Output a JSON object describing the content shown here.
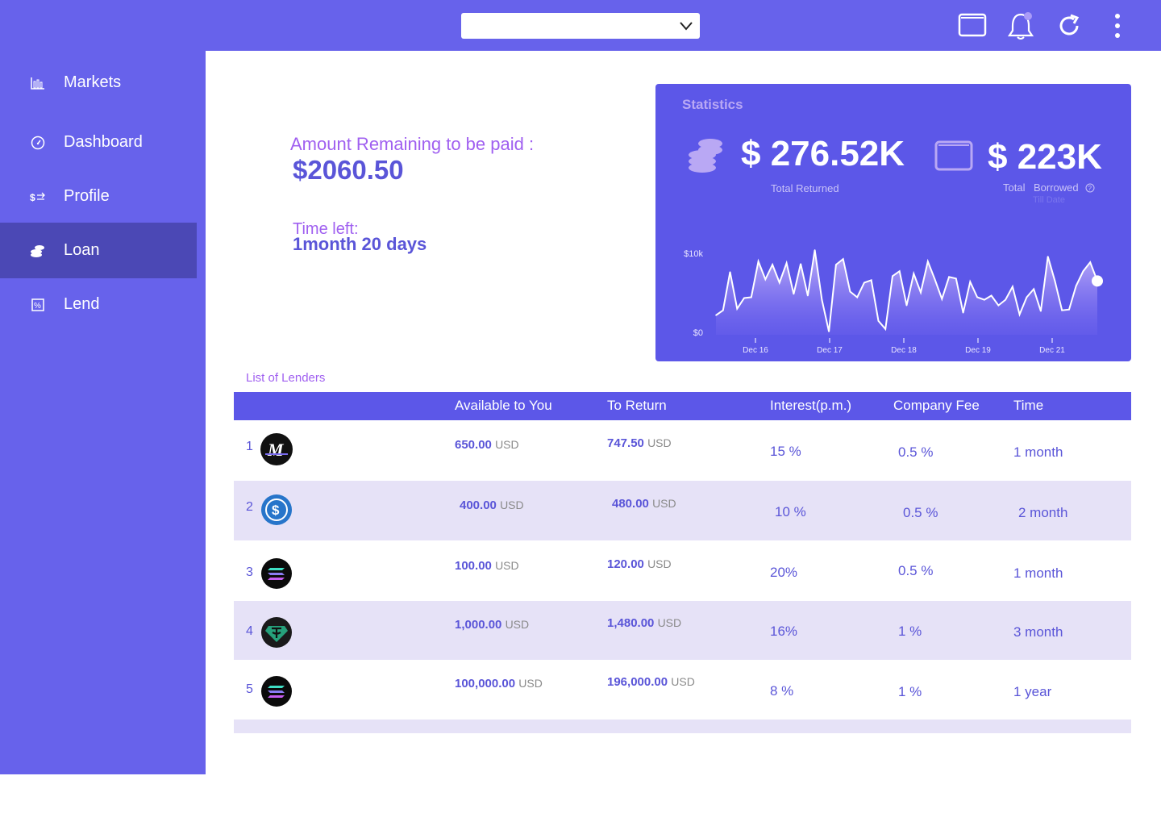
{
  "topbar": {
    "select_value": "",
    "icons": [
      "wallet-icon",
      "bell-icon",
      "refresh-icon",
      "more-vertical-icon"
    ]
  },
  "sidebar": {
    "items": [
      {
        "label": "Markets",
        "icon": "bar-chart-icon",
        "active": false
      },
      {
        "label": "Dashboard",
        "icon": "gauge-icon",
        "active": false
      },
      {
        "label": "Profile",
        "icon": "exchange-icon",
        "active": false
      },
      {
        "label": "Loan",
        "icon": "coins-icon",
        "active": true
      },
      {
        "label": "Lend",
        "icon": "percent-icon",
        "active": false
      }
    ]
  },
  "loan_summary": {
    "amount_label": "Amount Remaining to be paid :",
    "amount_value": "$2060.50",
    "time_label": "Time left:",
    "time_value": "1month 20 days"
  },
  "statistics": {
    "title": "Statistics",
    "total_returned_value": "$ 276.52K",
    "total_returned_label": "Total Returned",
    "total_borrowed_value": "$ 223K",
    "total_borrowed_label_1": "Total",
    "total_borrowed_label_2": "Borrowed",
    "till_date": "Till Date",
    "accent": "#5c57e8"
  },
  "chart_data": {
    "type": "area",
    "y_tick_labels": [
      "$10k",
      "$0"
    ],
    "x_tick_labels": [
      "Dec 16",
      "Dec 17",
      "Dec 18",
      "Dec 19",
      "Dec 21"
    ],
    "ylim": [
      0,
      10000
    ],
    "values": [
      2400,
      3000,
      7700,
      3200,
      4500,
      4600,
      9000,
      6800,
      8600,
      6400,
      8800,
      5000,
      8700,
      4800,
      10400,
      4300,
      400,
      8600,
      9300,
      5300,
      4600,
      6400,
      6700,
      1700,
      700,
      7200,
      7800,
      3600,
      7500,
      5200,
      9000,
      6800,
      4400,
      7100,
      6900,
      2700,
      6500,
      4600,
      4300,
      4800,
      3600,
      4300,
      5900,
      2500,
      4600,
      5600,
      2900,
      9600,
      6600,
      3000,
      3100,
      6000,
      7800,
      8900,
      6600
    ],
    "grid": false,
    "legend": "none"
  },
  "lenders": {
    "title": "List of Lenders",
    "columns": [
      "Available to You",
      "To Return",
      "Interest(p.m.)",
      "Company Fee",
      "Time"
    ],
    "rows": [
      {
        "index": "1",
        "coin": "m-coin-icon",
        "available": "650.00",
        "available_unit": "USD",
        "return": "747.50",
        "return_unit": "USD",
        "interest": "15 %",
        "fee": "0.5 %",
        "time": "1 month"
      },
      {
        "index": "2",
        "coin": "usdc-coin-icon",
        "available": "400.00",
        "available_unit": "USD",
        "return": "480.00",
        "return_unit": "USD",
        "interest": "10 %",
        "fee": "0.5 %",
        "time": "2 month"
      },
      {
        "index": "3",
        "coin": "solana-coin-icon",
        "available": "100.00",
        "available_unit": "USD",
        "return": "120.00",
        "return_unit": "USD",
        "interest": "20%",
        "fee": "0.5 %",
        "time": "1 month"
      },
      {
        "index": "4",
        "coin": "tether-coin-icon",
        "available": "1,000.00",
        "available_unit": "USD",
        "return": "1,480.00",
        "return_unit": "USD",
        "interest": "16%",
        "fee": "1 %",
        "time": "3 month"
      },
      {
        "index": "5",
        "coin": "solana-coin-icon",
        "available": "100,000.00",
        "available_unit": "USD",
        "return": "196,000.00",
        "return_unit": "USD",
        "interest": "8 %",
        "fee": "1 %",
        "time": "1 year"
      }
    ]
  }
}
